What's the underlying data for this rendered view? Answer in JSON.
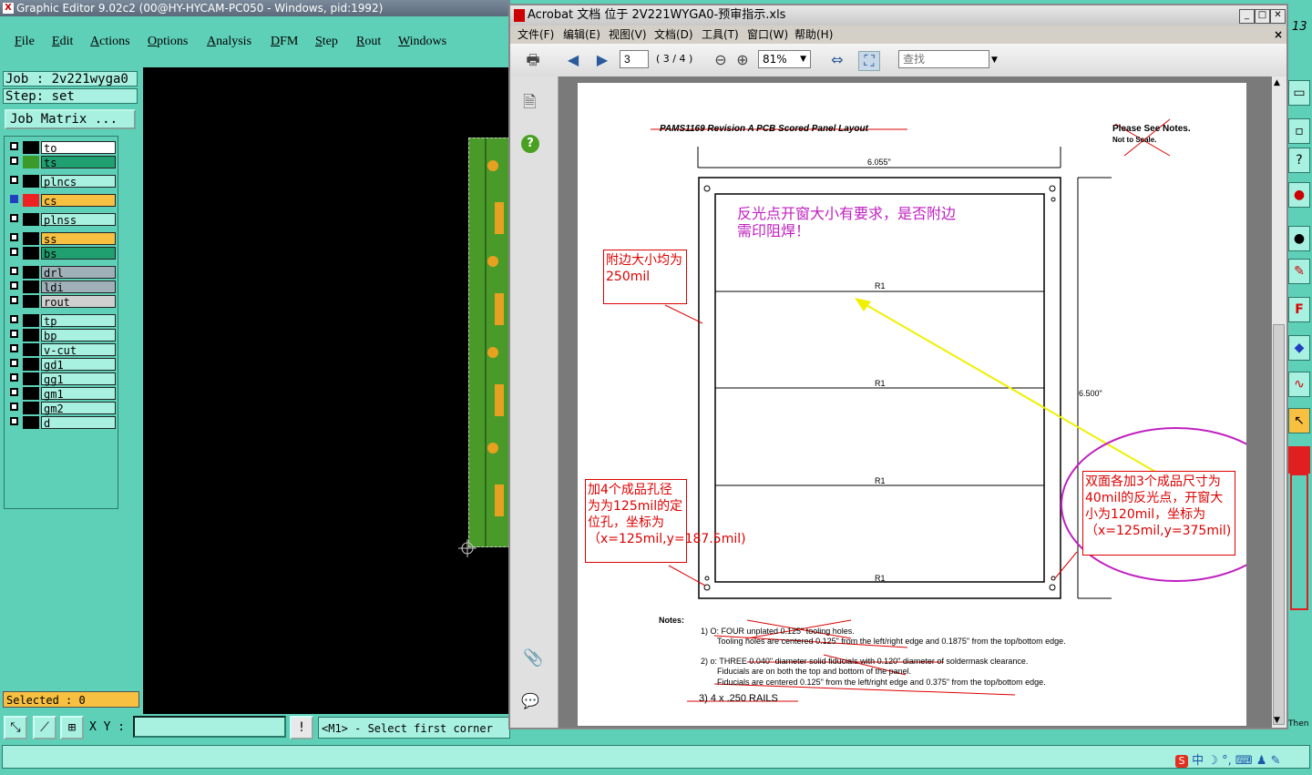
{
  "ge": {
    "title": "Graphic Editor 9.02c2 (00@HY-HYCAM-PC050 - Windows, pid:1992)",
    "menus": [
      "File",
      "Edit",
      "Actions",
      "Options",
      "Analysis",
      "DFM",
      "Step",
      "Rout",
      "Windows"
    ],
    "job": "Job : 2v221wyga0",
    "step": "Step: set",
    "job_matrix": "Job Matrix ...",
    "layers": [
      {
        "name": "to",
        "color": "#ffffff",
        "swatch": "#000000"
      },
      {
        "name": "ts",
        "color": "#20a070",
        "swatch": "#3a9a2a"
      },
      {
        "name": "plncs",
        "color": "#a8f0e0",
        "swatch": "#000000"
      },
      {
        "name": "cs",
        "color": "#f8c040",
        "swatch": "#ee2222"
      },
      {
        "name": "plnss",
        "color": "#a8f0e0",
        "swatch": "#000000"
      },
      {
        "name": "ss",
        "color": "#f8c040",
        "swatch": "#000000"
      },
      {
        "name": "bs",
        "color": "#20a070",
        "swatch": "#000000"
      },
      {
        "name": "drl",
        "color": "#a0b0b8",
        "swatch": "#000000"
      },
      {
        "name": "ldi",
        "color": "#a0b0b8",
        "swatch": "#000000"
      },
      {
        "name": "rout",
        "color": "#d0d0d0",
        "swatch": "#000000"
      },
      {
        "name": "tp",
        "color": "#a8f0e0",
        "swatch": "#000000"
      },
      {
        "name": "bp",
        "color": "#a8f0e0",
        "swatch": "#000000"
      },
      {
        "name": "v-cut",
        "color": "#a8f0e0",
        "swatch": "#000000"
      },
      {
        "name": "gd1",
        "color": "#a8f0e0",
        "swatch": "#000000"
      },
      {
        "name": "gg1",
        "color": "#a8f0e0",
        "swatch": "#000000"
      },
      {
        "name": "gm1",
        "color": "#a8f0e0",
        "swatch": "#000000"
      },
      {
        "name": "gm2",
        "color": "#a8f0e0",
        "swatch": "#000000"
      },
      {
        "name": "d",
        "color": "#a8f0e0",
        "swatch": "#000000"
      }
    ],
    "selected": "Selected : 0",
    "xy_label": "X Y :",
    "status": "<M1> - Select first corner",
    "then_label": "Then",
    "right_top": "13"
  },
  "acrobat": {
    "title": "Acrobat 文档 位于 2V221WYGA0-预审指示.xls",
    "menus": [
      "文件(F)",
      "编辑(E)",
      "视图(V)",
      "文档(D)",
      "工具(T)",
      "窗口(W)",
      "帮助(H)"
    ],
    "page_input": "3",
    "page_count": "( 3 / 4 )",
    "zoom": "81%",
    "search_placeholder": "查找"
  },
  "pdf": {
    "heading": "PAMS1169 Revision A PCB Scored Panel Layout",
    "notes_top": "Please See Notes.",
    "not_scale": "Not to Scale.",
    "width_dim": "6.055\"",
    "height_dim": "6.500\"",
    "r_labels": [
      "R1",
      "R1",
      "R1",
      "R1"
    ],
    "ann_purple": "反光点开窗大小有要求，是否附边需印阻焊！",
    "ann_rail": "附边大小均为250mil",
    "ann_holes": "加4个成品孔径为为125mil的定位孔，坐标为（x=125mil,y=187.5mil)",
    "ann_fid": "双面各加3个成品尺寸为40mil的反光点，开窗大小为120mil，坐标为（x=125mil,y=375mil)",
    "notes_label": "Notes:",
    "note1a": "1)    O: FOUR unplated 0.125\" tooling holes.",
    "note1b": "Tooling holes are centered 0.125\" from the left/right edge and 0.1875\" from the top/bottom edge.",
    "note2a": "2)    o: THREE 0.040\" diameter solid fiducials with 0.120\" diameter of soldermask clearance.",
    "note2b": "Fiducials are on both the top and bottom of the panel.",
    "note2c": "Fiducials are centered 0.125\" from the left/right edge and 0.375\" from the top/bottom edge.",
    "note3": "3) 4 x .250 RAILS"
  },
  "tray": {
    "ime": "中"
  }
}
